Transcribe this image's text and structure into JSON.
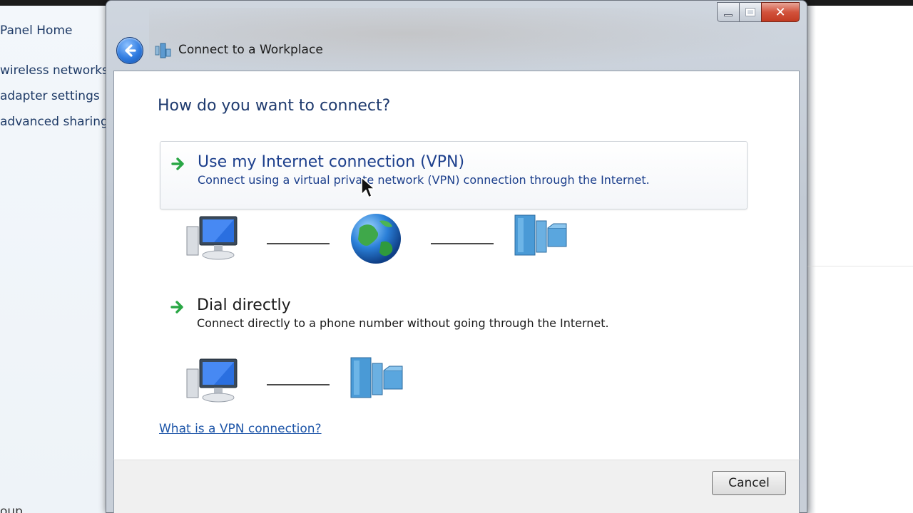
{
  "background_panel": {
    "links": [
      "Panel Home",
      "wireless networks",
      "adapter settings",
      "advanced sharing"
    ],
    "bottom_fragment": "oup"
  },
  "window": {
    "title": "Connect to a Workplace",
    "caption_buttons": [
      "minimize-icon",
      "maximize-icon",
      "close-icon"
    ]
  },
  "heading": "How do you want to connect?",
  "options": [
    {
      "title": "Use my Internet connection (VPN)",
      "description": "Connect using a virtual private network (VPN) connection through the Internet."
    },
    {
      "title": "Dial directly",
      "description": "Connect directly to a phone number without going through the Internet."
    }
  ],
  "help_link": "What is a VPN connection?",
  "footer": {
    "cancel_label": "Cancel"
  },
  "colors": {
    "link_blue": "#1c3f8c",
    "heading_blue": "#1e3a6e",
    "arrow_green": "#2aa745"
  }
}
